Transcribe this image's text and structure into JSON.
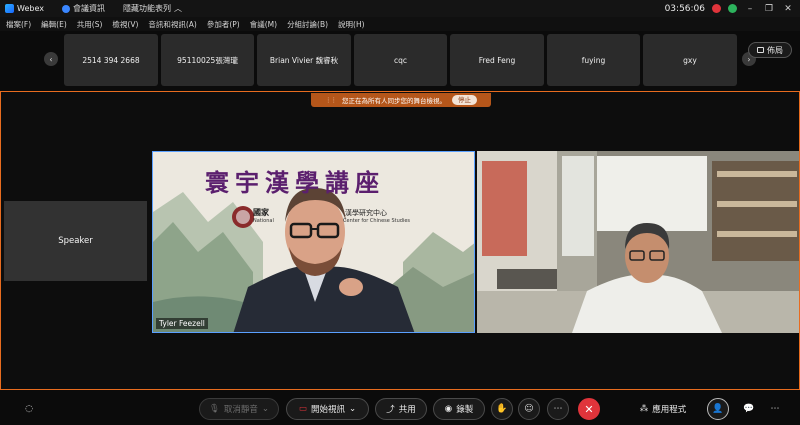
{
  "titlebar": {
    "app": "Webex",
    "meeting_info": "會議資訊",
    "hide_menu": "隱藏功能表列",
    "time": "03:56:06"
  },
  "menu": [
    "檔案(F)",
    "編輯(E)",
    "共用(S)",
    "檢視(V)",
    "音訊和視訊(A)",
    "參加者(P)",
    "會議(M)",
    "分組討論(B)",
    "說明(H)"
  ],
  "participants": [
    "2514 394 2668",
    "95110025張灣瓏",
    "Brian Vivier 魏睿秋",
    "cqc",
    "Fred Feng",
    "fuying",
    "gxy"
  ],
  "layout_label": "佈局",
  "sync_banner": {
    "text": "您正在為所有人同步您的舞台檢視。",
    "stop": "停止"
  },
  "speaker_label": "Speaker",
  "videos": {
    "v1_name": "Tyler Feezell",
    "slide_title": "寰宇漢學講座",
    "slide_org": "國家",
    "slide_org_en": "National",
    "slide_center": "漢學研究中心",
    "slide_center_en": "Center for Chinese Studies"
  },
  "toolbar": {
    "unmute": "取消靜音",
    "start_video": "開始視訊",
    "share": "共用",
    "record": "錄製",
    "apps": "應用程式"
  },
  "colors": {
    "accent": "#e86c1f",
    "active_speaker": "#5aa0ff",
    "end_call": "#e0343b"
  }
}
